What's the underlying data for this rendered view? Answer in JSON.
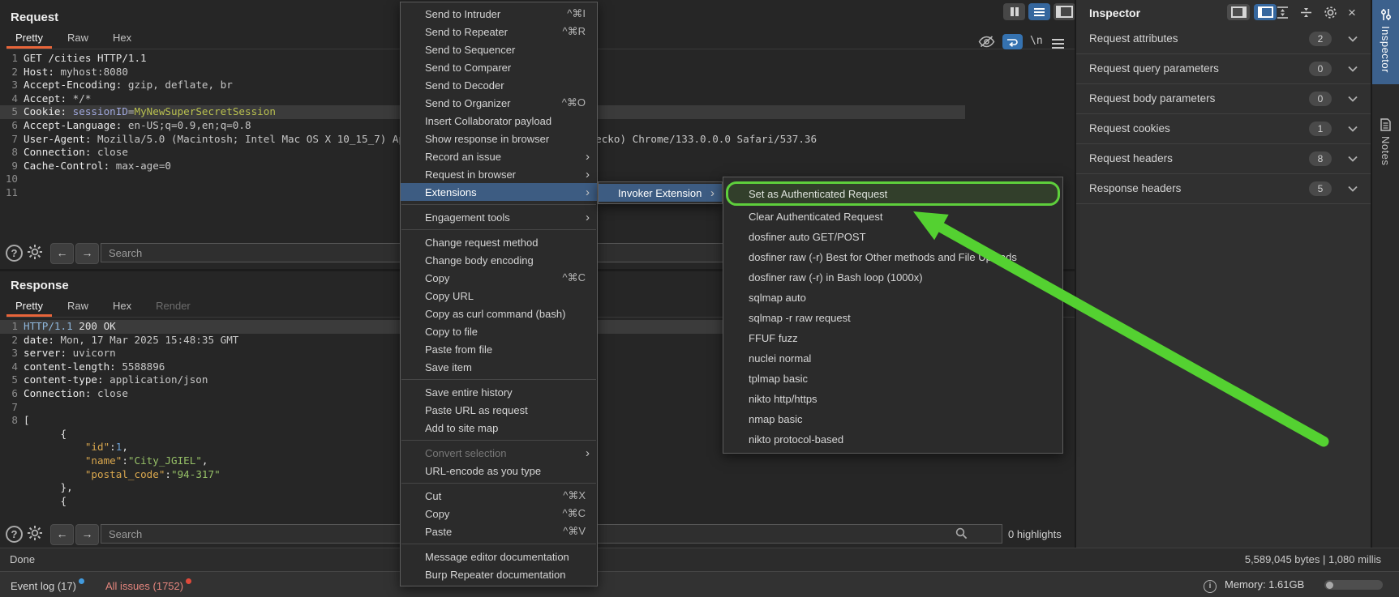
{
  "colors": {
    "accent_orange": "#e8653a",
    "selection_blue": "#3d5c82",
    "annotation_green": "#54d131",
    "issues_red": "#e0493a",
    "eventlog_blue": "#429add",
    "json_key": "#d9a74e",
    "json_num": "#6c9fd4",
    "json_str": "#96c067"
  },
  "window": {
    "layout_buttons": [
      "split-columns-icon",
      "split-rows-icon",
      "single-panel-icon"
    ],
    "header_icons": [
      "expand-all-icon",
      "collapse-all-icon",
      "settings-gear-icon",
      "close-icon"
    ]
  },
  "request_panel": {
    "title": "Request",
    "tabs": [
      {
        "label": "Pretty",
        "active": true
      },
      {
        "label": "Raw"
      },
      {
        "label": "Hex"
      }
    ],
    "editor_icons": [
      "eye-slash-icon",
      "soft-wrap-icon",
      "newline-icon",
      "menu-icon"
    ],
    "newline_icon_label": "\\n",
    "search": {
      "placeholder": "Search",
      "highlights": "0 highlights"
    },
    "lines": [
      {
        "n": "1",
        "segs": [
          {
            "c": "p",
            "t": "GET /cities HTTP/1.1"
          }
        ]
      },
      {
        "n": "2",
        "segs": [
          {
            "c": "n",
            "t": "Host:"
          },
          {
            "c": "v",
            "t": " myhost:8080"
          }
        ]
      },
      {
        "n": "3",
        "segs": [
          {
            "c": "n",
            "t": "Accept-Encoding:"
          },
          {
            "c": "v",
            "t": " gzip, deflate, br"
          }
        ]
      },
      {
        "n": "4",
        "segs": [
          {
            "c": "n",
            "t": "Accept:"
          },
          {
            "c": "v",
            "t": " */*"
          }
        ]
      },
      {
        "n": "5",
        "hl": true,
        "segs": [
          {
            "c": "n",
            "t": "Cookie:"
          },
          {
            "c": "v",
            "t": " "
          },
          {
            "c": "ck",
            "t": "sessionID"
          },
          {
            "c": "v",
            "t": "="
          },
          {
            "c": "cv",
            "t": "MyNewSuperSecretSession"
          }
        ]
      },
      {
        "n": "6",
        "segs": [
          {
            "c": "n",
            "t": "Accept-Language:"
          },
          {
            "c": "v",
            "t": " en-US;q=0.9,en;q=0.8"
          }
        ]
      },
      {
        "n": "7",
        "segs": [
          {
            "c": "n",
            "t": "User-Agent:"
          },
          {
            "c": "v",
            "t": " Mozilla/5.0 (Macintosh; Intel Mac OS X 10_15_7) AppleWebKit/537.36 (KHTML, like Gecko) Chrome/133.0.0.0 Safari/537.36"
          }
        ]
      },
      {
        "n": "8",
        "segs": [
          {
            "c": "n",
            "t": "Connection:"
          },
          {
            "c": "v",
            "t": " close"
          }
        ]
      },
      {
        "n": "9",
        "segs": [
          {
            "c": "n",
            "t": "Cache-Control:"
          },
          {
            "c": "v",
            "t": " max-age=0"
          }
        ]
      },
      {
        "n": "10",
        "segs": []
      },
      {
        "n": "11",
        "segs": []
      }
    ]
  },
  "response_panel": {
    "title": "Response",
    "tabs": [
      {
        "label": "Pretty",
        "active": true
      },
      {
        "label": "Raw"
      },
      {
        "label": "Hex"
      },
      {
        "label": "Render",
        "disabled": true
      }
    ],
    "search": {
      "placeholder": "Search",
      "highlights": "0 highlights"
    },
    "lines": [
      {
        "n": "1",
        "hl": true,
        "segs": [
          {
            "c": "http",
            "t": "HTTP/1.1"
          },
          {
            "c": "p",
            "t": " 200 OK"
          }
        ]
      },
      {
        "n": "2",
        "segs": [
          {
            "c": "n",
            "t": "date:"
          },
          {
            "c": "v",
            "t": " Mon, 17 Mar 2025 15:48:35 GMT"
          }
        ]
      },
      {
        "n": "3",
        "segs": [
          {
            "c": "n",
            "t": "server:"
          },
          {
            "c": "v",
            "t": " uvicorn"
          }
        ]
      },
      {
        "n": "4",
        "segs": [
          {
            "c": "n",
            "t": "content-length:"
          },
          {
            "c": "v",
            "t": " 5588896"
          }
        ]
      },
      {
        "n": "5",
        "segs": [
          {
            "c": "n",
            "t": "content-type:"
          },
          {
            "c": "v",
            "t": " application/json"
          }
        ]
      },
      {
        "n": "6",
        "segs": [
          {
            "c": "n",
            "t": "Connection:"
          },
          {
            "c": "v",
            "t": " close"
          }
        ]
      },
      {
        "n": "7",
        "segs": []
      },
      {
        "n": "8",
        "segs": [
          {
            "c": "p",
            "t": "["
          }
        ]
      },
      {
        "n": "",
        "segs": [
          {
            "c": "p",
            "t": "      {"
          }
        ]
      },
      {
        "n": "",
        "segs": [
          {
            "c": "p",
            "t": "          "
          },
          {
            "c": "key",
            "t": "\"id\""
          },
          {
            "c": "p",
            "t": ":"
          },
          {
            "c": "num",
            "t": "1"
          },
          {
            "c": "p",
            "t": ","
          }
        ]
      },
      {
        "n": "",
        "segs": [
          {
            "c": "p",
            "t": "          "
          },
          {
            "c": "key",
            "t": "\"name\""
          },
          {
            "c": "p",
            "t": ":"
          },
          {
            "c": "str",
            "t": "\"City_JGIEL\""
          },
          {
            "c": "p",
            "t": ","
          }
        ]
      },
      {
        "n": "",
        "segs": [
          {
            "c": "p",
            "t": "          "
          },
          {
            "c": "key",
            "t": "\"postal_code\""
          },
          {
            "c": "p",
            "t": ":"
          },
          {
            "c": "str",
            "t": "\"94-317\""
          }
        ]
      },
      {
        "n": "",
        "segs": [
          {
            "c": "p",
            "t": "      },"
          }
        ]
      },
      {
        "n": "",
        "segs": [
          {
            "c": "p",
            "t": "      {"
          }
        ]
      }
    ]
  },
  "status": {
    "done": "Done",
    "metrics": "5,589,045 bytes | 1,080 millis"
  },
  "bottom_bar": {
    "event_log": "Event log (17)",
    "all_issues": "All issues (1752)",
    "memory": "Memory: 1.61GB"
  },
  "context_menu": {
    "items": [
      {
        "label": "Send to Intruder",
        "shortcut": "^⌘I"
      },
      {
        "label": "Send to Repeater",
        "shortcut": "^⌘R"
      },
      {
        "label": "Send to Sequencer"
      },
      {
        "label": "Send to Comparer"
      },
      {
        "label": "Send to Decoder"
      },
      {
        "label": "Send to Organizer",
        "shortcut": "^⌘O"
      },
      {
        "label": "Insert Collaborator payload"
      },
      {
        "label": "Show response in browser"
      },
      {
        "label": "Record an issue",
        "arrow": true
      },
      {
        "label": "Request in browser",
        "arrow": true
      },
      {
        "label": "Extensions",
        "arrow": true,
        "selected": true
      },
      {
        "sep": true
      },
      {
        "label": "Engagement tools",
        "arrow": true
      },
      {
        "sep": true
      },
      {
        "label": "Change request method"
      },
      {
        "label": "Change body encoding"
      },
      {
        "label": "Copy",
        "shortcut": "^⌘C"
      },
      {
        "label": "Copy URL"
      },
      {
        "label": "Copy as curl command (bash)"
      },
      {
        "label": "Copy to file"
      },
      {
        "label": "Paste from file"
      },
      {
        "label": "Save item"
      },
      {
        "sep": true
      },
      {
        "label": "Save entire history"
      },
      {
        "label": "Paste URL as request"
      },
      {
        "label": "Add to site map"
      },
      {
        "sep": true
      },
      {
        "label": "Convert selection",
        "arrow": true,
        "disabled": true
      },
      {
        "label": "URL-encode as you type"
      },
      {
        "sep": true
      },
      {
        "label": "Cut",
        "shortcut": "^⌘X"
      },
      {
        "label": "Copy",
        "shortcut": "^⌘C"
      },
      {
        "label": "Paste",
        "shortcut": "^⌘V"
      },
      {
        "sep": true
      },
      {
        "label": "Message editor documentation"
      },
      {
        "label": "Burp Repeater documentation"
      }
    ]
  },
  "invoker_menu": {
    "label": "Invoker Extension"
  },
  "extension_menu": {
    "items": [
      {
        "label": "Set as Authenticated Request",
        "selected": true
      },
      {
        "label": "Clear Authenticated Request"
      },
      {
        "label": "dosfiner auto GET/POST"
      },
      {
        "label": "dosfiner raw (-r) Best for Other methods and File Uploads"
      },
      {
        "label": "dosfiner raw (-r) in Bash loop (1000x)"
      },
      {
        "label": "sqlmap auto"
      },
      {
        "label": "sqlmap -r raw request"
      },
      {
        "label": "FFUF fuzz"
      },
      {
        "label": "nuclei normal"
      },
      {
        "label": "tplmap basic"
      },
      {
        "label": "nikto http/https"
      },
      {
        "label": "nmap basic"
      },
      {
        "label": "nikto protocol-based"
      }
    ]
  },
  "inspector": {
    "title": "Inspector",
    "sections": [
      {
        "label": "Request attributes",
        "count": "2"
      },
      {
        "label": "Request query parameters",
        "count": "0"
      },
      {
        "label": "Request body parameters",
        "count": "0"
      },
      {
        "label": "Request cookies",
        "count": "1"
      },
      {
        "label": "Request headers",
        "count": "8"
      },
      {
        "label": "Response headers",
        "count": "5"
      }
    ]
  },
  "side_rail": {
    "tabs": [
      {
        "label": "Inspector",
        "active": true
      },
      {
        "label": "Notes"
      }
    ]
  }
}
